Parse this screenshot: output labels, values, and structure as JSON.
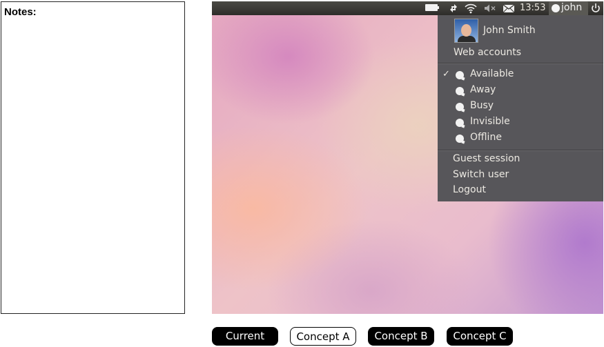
{
  "notes": {
    "title": "Notes:"
  },
  "panel": {
    "clock": "13:53",
    "username": "john",
    "icons": [
      "battery-icon",
      "network-icon",
      "wifi-icon",
      "speaker-muted-icon",
      "mail-icon",
      "user-status-icon",
      "power-icon"
    ]
  },
  "menu": {
    "full_name": "John Smith",
    "web_accounts": "Web accounts",
    "statuses": [
      {
        "label": "Available",
        "checked": true
      },
      {
        "label": "Away",
        "checked": false
      },
      {
        "label": "Busy",
        "checked": false
      },
      {
        "label": "Invisible",
        "checked": false
      },
      {
        "label": "Offline",
        "checked": false
      }
    ],
    "check_mark": "✓",
    "guest_session": "Guest session",
    "switch_user": "Switch user",
    "logout": "Logout"
  },
  "concepts": {
    "current": "Current",
    "concept_a": "Concept A",
    "concept_b": "Concept B",
    "concept_c": "Concept C",
    "selected": "Concept A"
  },
  "colors": {
    "panel": "#3a3935",
    "menu": "#57565a",
    "menu_text": "#ece9e2"
  }
}
